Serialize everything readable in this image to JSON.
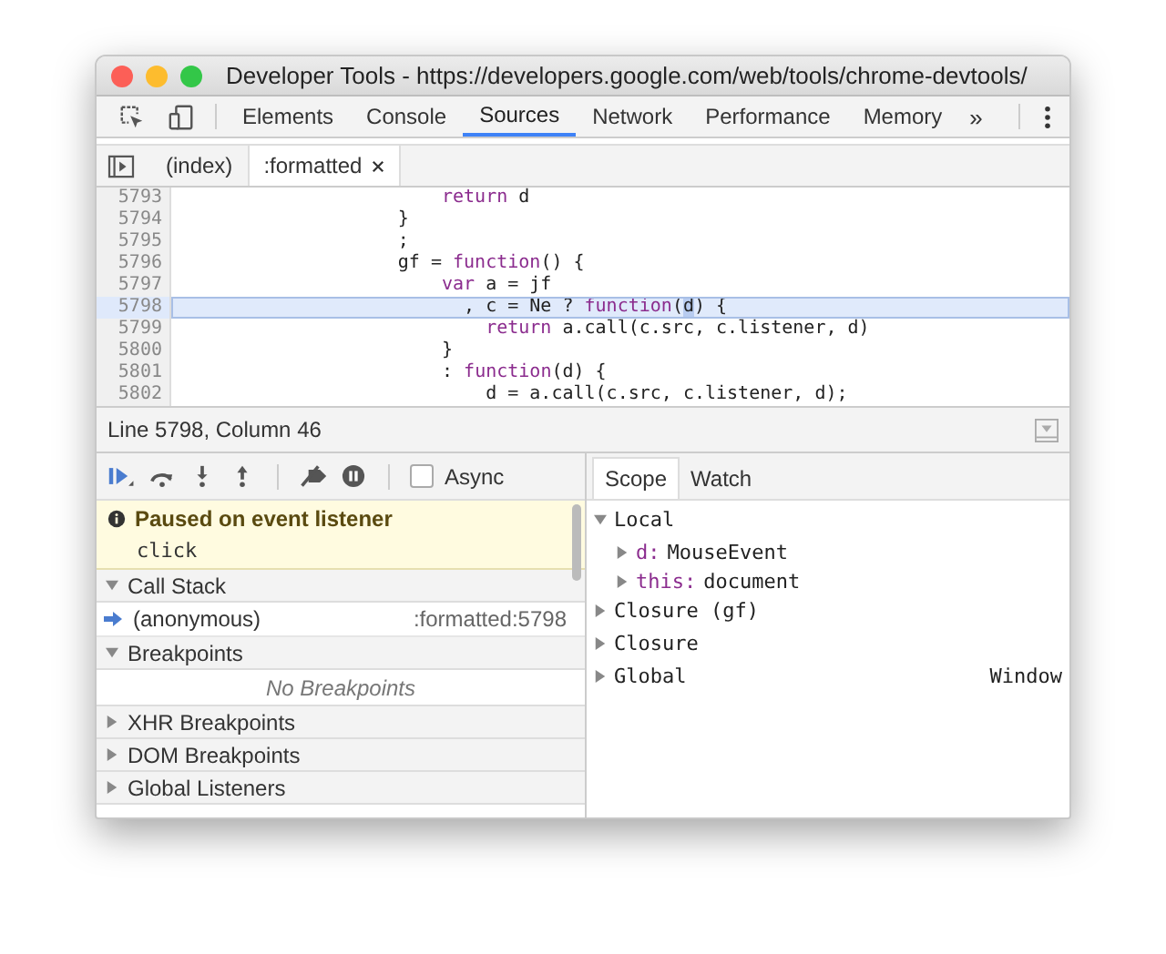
{
  "window": {
    "title": "Developer Tools - https://developers.google.com/web/tools/chrome-devtools/"
  },
  "panel_tabs": [
    {
      "label": "Elements",
      "selected": false
    },
    {
      "label": "Console",
      "selected": false
    },
    {
      "label": "Sources",
      "selected": true
    },
    {
      "label": "Network",
      "selected": false
    },
    {
      "label": "Performance",
      "selected": false
    },
    {
      "label": "Memory",
      "selected": false
    }
  ],
  "more_tabs": "»",
  "file_tabs": [
    {
      "label": "(index)",
      "selected": false,
      "closable": false
    },
    {
      "label": ":formatted",
      "selected": true,
      "closable": true
    }
  ],
  "code_lines": [
    {
      "number": "5793",
      "highlighted": false,
      "segments": [
        {
          "text": "                        return",
          "kind": "keyword"
        },
        {
          "text": " d",
          "kind": "plain"
        }
      ]
    },
    {
      "number": "5794",
      "highlighted": false,
      "segments": [
        {
          "text": "                    }",
          "kind": "plain"
        }
      ]
    },
    {
      "number": "5795",
      "highlighted": false,
      "segments": [
        {
          "text": "                    ;",
          "kind": "plain"
        }
      ]
    },
    {
      "number": "5796",
      "highlighted": false,
      "segments": [
        {
          "text": "                    gf = ",
          "kind": "plain"
        },
        {
          "text": "function",
          "kind": "keyword"
        },
        {
          "text": "() {",
          "kind": "plain"
        }
      ]
    },
    {
      "number": "5797",
      "highlighted": false,
      "segments": [
        {
          "text": "                        var",
          "kind": "keyword"
        },
        {
          "text": " a = jf",
          "kind": "plain"
        }
      ]
    },
    {
      "number": "5798",
      "highlighted": true,
      "segments": [
        {
          "text": "                          , c = Ne ? ",
          "kind": "plain"
        },
        {
          "text": "function",
          "kind": "keyword"
        },
        {
          "text": "(",
          "kind": "plain"
        },
        {
          "text": "d",
          "kind": "selection"
        },
        {
          "text": ") {",
          "kind": "plain"
        }
      ]
    },
    {
      "number": "5799",
      "highlighted": false,
      "segments": [
        {
          "text": "                            return",
          "kind": "keyword"
        },
        {
          "text": " a.call(c.src, c.listener, d)",
          "kind": "plain"
        }
      ]
    },
    {
      "number": "5800",
      "highlighted": false,
      "segments": [
        {
          "text": "                        }",
          "kind": "plain"
        }
      ]
    },
    {
      "number": "5801",
      "highlighted": false,
      "segments": [
        {
          "text": "                        : ",
          "kind": "plain"
        },
        {
          "text": "function",
          "kind": "keyword"
        },
        {
          "text": "(d) {",
          "kind": "plain"
        }
      ]
    },
    {
      "number": "5802",
      "highlighted": false,
      "segments": [
        {
          "text": "                            d = a.call(c.src, c.listener, d);",
          "kind": "plain"
        }
      ]
    }
  ],
  "status_bar": {
    "position": "Line 5798, Column 46"
  },
  "debugger": {
    "async": {
      "label": "Async",
      "checked": false
    },
    "paused": {
      "title": "Paused on event listener",
      "detail": "click"
    },
    "sections": [
      {
        "title": "Call Stack",
        "expanded": true,
        "frames": [
          {
            "name": "(anonymous)",
            "location": ":formatted:5798",
            "current": true
          }
        ]
      },
      {
        "title": "Breakpoints",
        "expanded": true,
        "empty_text": "No Breakpoints"
      },
      {
        "title": "XHR Breakpoints",
        "expanded": false
      },
      {
        "title": "DOM Breakpoints",
        "expanded": false
      },
      {
        "title": "Global Listeners",
        "expanded": false
      }
    ]
  },
  "sidebar_tabs": [
    {
      "label": "Scope",
      "selected": true
    },
    {
      "label": "Watch",
      "selected": false
    }
  ],
  "scope": [
    {
      "name": "Local",
      "expanded": true,
      "children": [
        {
          "name": "d:",
          "value": "MouseEvent",
          "expanded": false
        },
        {
          "name": "this:",
          "value": "document",
          "expanded": false
        }
      ]
    },
    {
      "name": "Closure (gf)",
      "expanded": false
    },
    {
      "name": "Closure",
      "expanded": false
    },
    {
      "name": "Global",
      "value": "Window",
      "expanded": false
    }
  ]
}
